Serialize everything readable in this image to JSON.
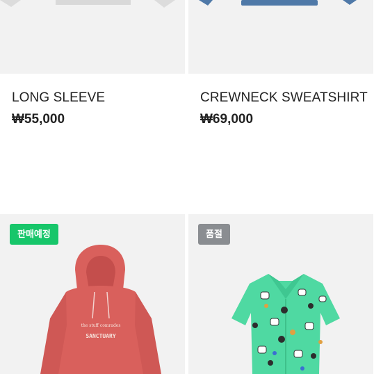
{
  "products": [
    {
      "name": "LONG SLEEVE",
      "price": "₩55,000",
      "image": "long-sleeve-tee-image"
    },
    {
      "name": "CREWNECK SWEATSHIRT",
      "price": "₩69,000",
      "image": "crewneck-sweatshirt-image"
    },
    {
      "badge": "판매예정",
      "badge_color": "#17c66a",
      "image": "red-hoodie-image",
      "print_line1": "the stuff comrades",
      "print_line2": "SANCTUARY"
    },
    {
      "badge": "품절",
      "badge_color": "#8a8d91",
      "image": "green-patterned-shirt-image"
    }
  ],
  "colors": {
    "image_background": "#f2f2f2",
    "text": "#222222",
    "hoodie": "#d9605c",
    "shirt": "#4fd9a2",
    "sweatshirt": "#4f79a8"
  }
}
